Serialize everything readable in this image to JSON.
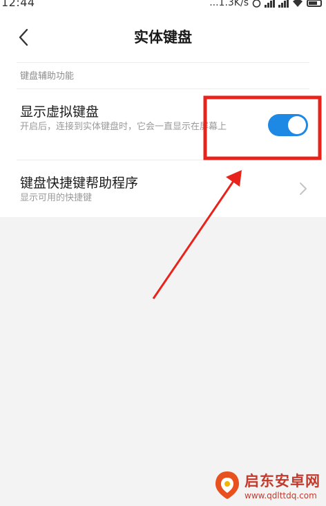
{
  "status_bar": {
    "time": "12:44",
    "net_speed": "...1.3K/s"
  },
  "header": {
    "title": "实体键盘"
  },
  "section": {
    "label": "键盘辅助功能"
  },
  "settings": [
    {
      "title": "显示虚拟键盘",
      "description": "开启后，连接到实体键盘时，它会一直显示在屏幕上",
      "toggle_on": true
    },
    {
      "title": "键盘快捷键帮助程序",
      "description": "显示可用的快捷键"
    }
  ],
  "watermark": {
    "name": "启东安卓网",
    "url": "www.qdlttdq.com"
  },
  "colors": {
    "toggle_on": "#1e88e5",
    "annotation_red": "#e8231b",
    "background": "#f3f3f3"
  }
}
